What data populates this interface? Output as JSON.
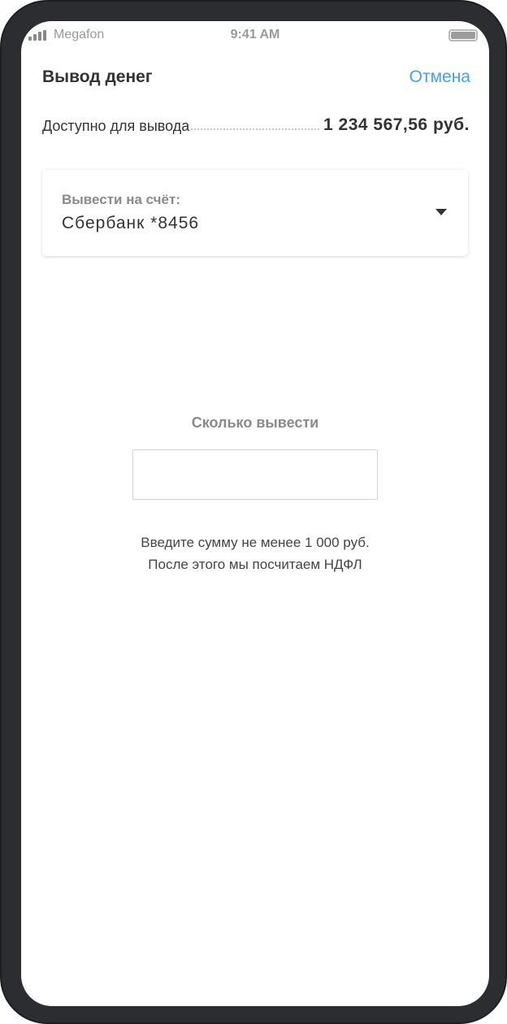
{
  "status_bar": {
    "carrier": "Megafon",
    "time": "9:41 AM"
  },
  "header": {
    "title": "Вывод денег",
    "cancel_label": "Отмена"
  },
  "available": {
    "label": "Доступно для вывода",
    "amount": "1 234 567,56 руб."
  },
  "account": {
    "label": "Вывести на счёт:",
    "value": "Сбербанк *8456"
  },
  "amount": {
    "label": "Сколько вывести",
    "value": "",
    "hint_line1": "Введите сумму не менее 1 000 руб.",
    "hint_line2": "После этого мы посчитаем НДФЛ"
  },
  "colors": {
    "frame": "#2c2d31",
    "accent": "#4a9ee6",
    "text_primary": "#333333",
    "text_secondary": "#8a8a8a"
  },
  "icons": {
    "signal": "signal-bars-icon",
    "battery": "battery-icon",
    "dropdown": "caret-down-icon"
  }
}
